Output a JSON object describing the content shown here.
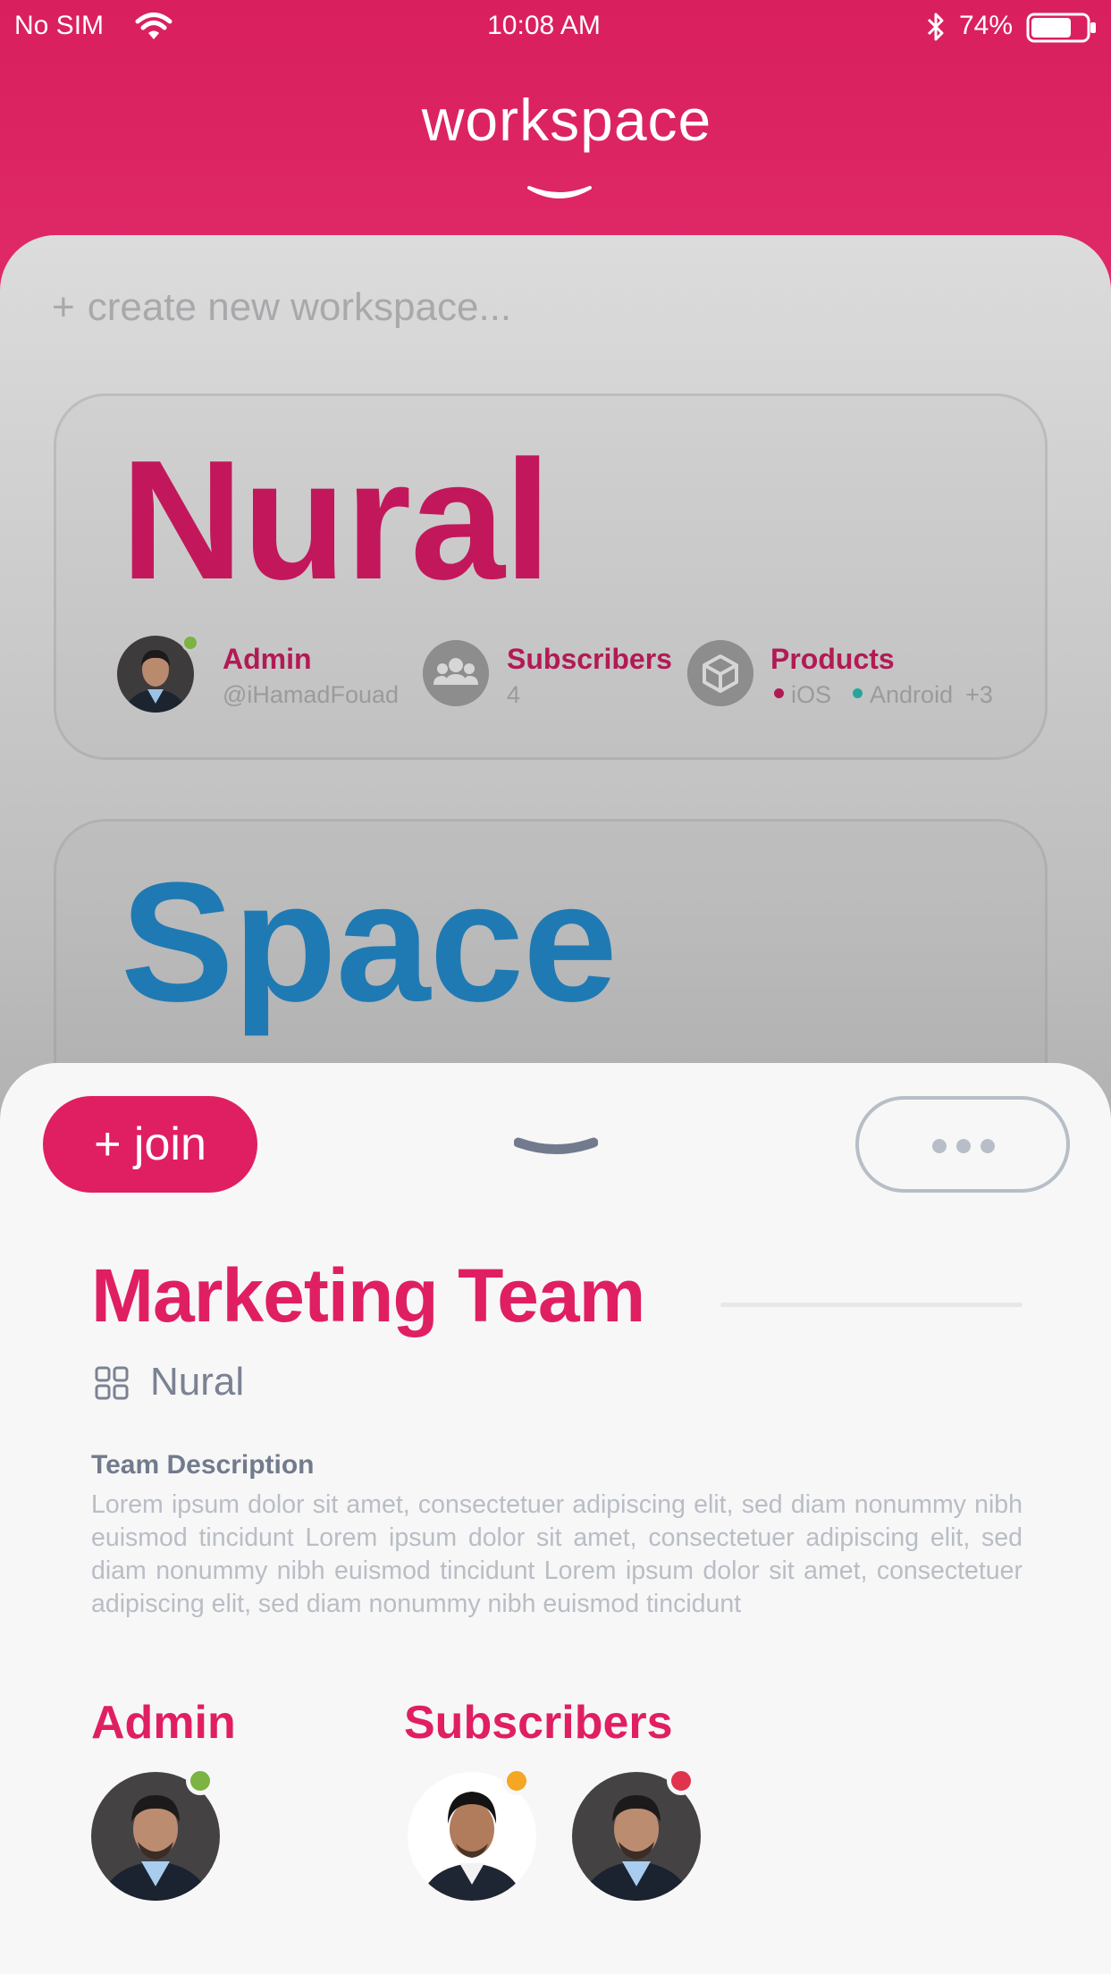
{
  "status_bar": {
    "carrier": "No SIM",
    "time": "10:08 AM",
    "battery_percent": "74%",
    "battery_level": 0.74
  },
  "header": {
    "title": "workspace"
  },
  "workspace_list": {
    "create_label": "create new workspace...",
    "create_prefix": "+",
    "workspaces": [
      {
        "name": "Nural",
        "color": "#c2185b",
        "admin_label": "Admin",
        "admin_handle": "@iHamadFouad",
        "subscribers_label": "Subscribers",
        "subscribers_count": "4",
        "products_label": "Products",
        "platforms": [
          "iOS",
          "Android"
        ],
        "platforms_more": "+3"
      },
      {
        "name": "Space",
        "color": "#1f7ab3"
      }
    ]
  },
  "detail": {
    "join_label": "+ join",
    "team_name": "Marketing Team",
    "workspace_name": "Nural",
    "description_heading": "Team Description",
    "description": "Lorem ipsum dolor sit amet, consectetuer adipiscing elit, sed diam nonummy nibh euismod tincidunt  Lorem ipsum dolor sit amet, consectetuer adipiscing elit, sed diam nonummy nibh euismod tincidunt Lorem ipsum dolor sit amet, consectetuer adipiscing elit, sed diam nonummy nibh euismod tincidunt",
    "admin_title": "Admin",
    "subscribers_title": "Subscribers",
    "admin_status_color": "#7cb342",
    "subscriber_status_colors": [
      "#f5a623",
      "#e0344d"
    ]
  }
}
